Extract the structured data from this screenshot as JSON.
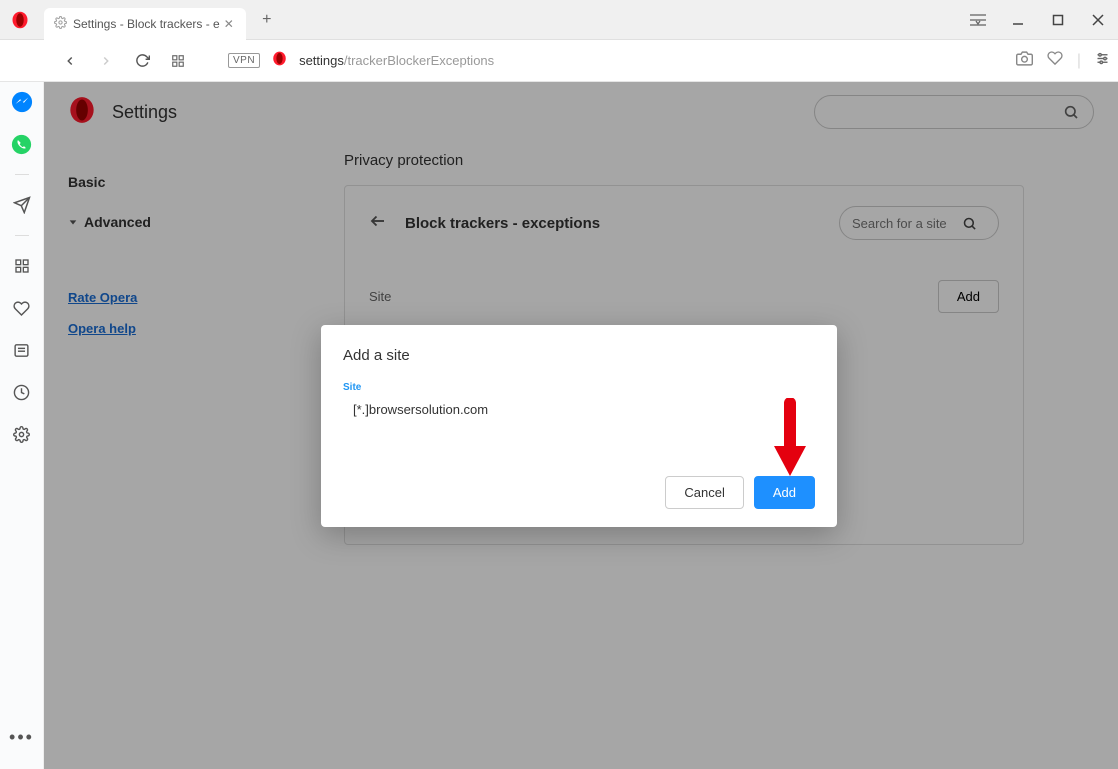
{
  "titlebar": {
    "tab_label": "Settings - Block trackers - e",
    "newtab_glyph": "+"
  },
  "addressbar": {
    "vpn_badge": "VPN",
    "url_base": "settings",
    "url_path": "/trackerBlockerExceptions"
  },
  "settings": {
    "title": "Settings"
  },
  "sidebar": {
    "basic": "Basic",
    "advanced": "Advanced",
    "rate": "Rate Opera",
    "help": "Opera help"
  },
  "main": {
    "section": "Privacy protection",
    "panel_title": "Block trackers - exceptions",
    "search_placeholder": "Search for a site",
    "site_label": "Site",
    "add_button": "Add"
  },
  "dialog": {
    "title": "Add a site",
    "field_label": "Site",
    "value": "[*.]browsersolution.com",
    "cancel": "Cancel",
    "add": "Add"
  }
}
